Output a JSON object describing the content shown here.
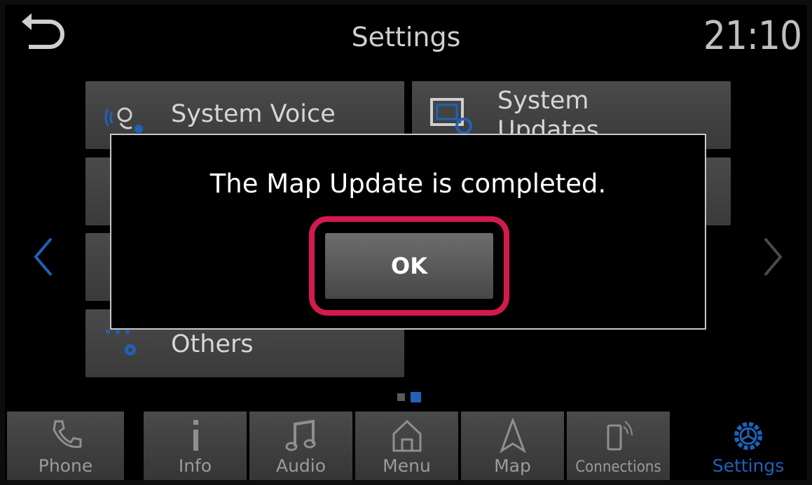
{
  "header": {
    "title": "Settings",
    "time": "21:10"
  },
  "tiles": [
    {
      "label": "System Voice",
      "icon": "system-voice-icon"
    },
    {
      "label_line1": "System",
      "label_line2": "Updates",
      "icon": "system-updates-icon"
    },
    {
      "label": "Others",
      "icon": "others-icon"
    }
  ],
  "pager": {
    "pages": 2,
    "current": 2
  },
  "dialog": {
    "message": "The Map Update is completed.",
    "ok_label": "OK"
  },
  "nav": [
    {
      "label": "Phone",
      "icon": "phone-icon"
    },
    {
      "label": "Info",
      "icon": "info-icon"
    },
    {
      "label": "Audio",
      "icon": "music-note-icon"
    },
    {
      "label": "Menu",
      "icon": "home-icon"
    },
    {
      "label": "Map",
      "icon": "navigation-arrow-icon"
    },
    {
      "label": "Connections",
      "icon": "phone-connection-icon"
    },
    {
      "label": "Settings",
      "icon": "gear-icon",
      "active": true
    }
  ],
  "colors": {
    "accent": "#1f62b8",
    "highlight": "#d31a4c"
  }
}
